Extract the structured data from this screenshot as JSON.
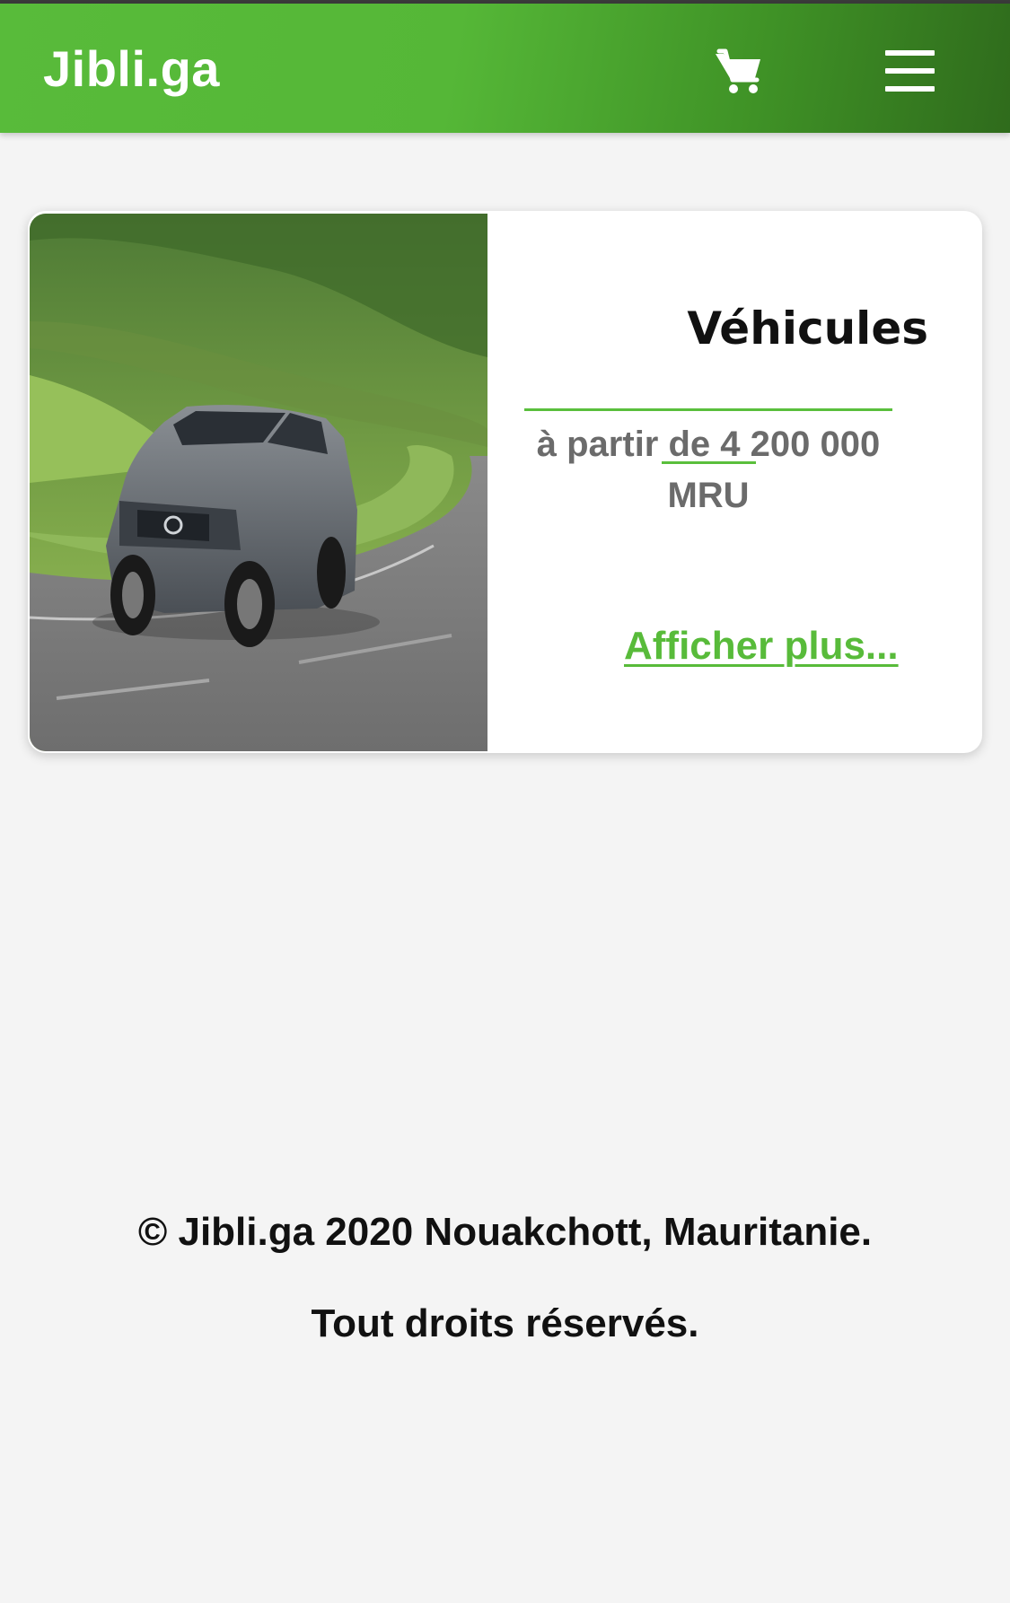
{
  "header": {
    "brand": "Jibli.ga",
    "cart_icon": "shopping-cart-icon",
    "menu_icon": "hamburger-menu-icon",
    "colors": {
      "gradient_start": "#58bb3a",
      "gradient_end": "#2f6b1c"
    }
  },
  "card": {
    "image_alt": "SUV on mountain road",
    "title": "Véhicules",
    "price_text": "à partir de 4 200 000 MRU",
    "link_label": "Afficher plus..."
  },
  "footer": {
    "line1": "© Jibli.ga 2020 Nouakchott, Mauritanie.",
    "line2": "Tout droits réservés."
  },
  "colors": {
    "accent": "#58bb3a",
    "background": "#f4f4f4",
    "card": "#ffffff"
  }
}
